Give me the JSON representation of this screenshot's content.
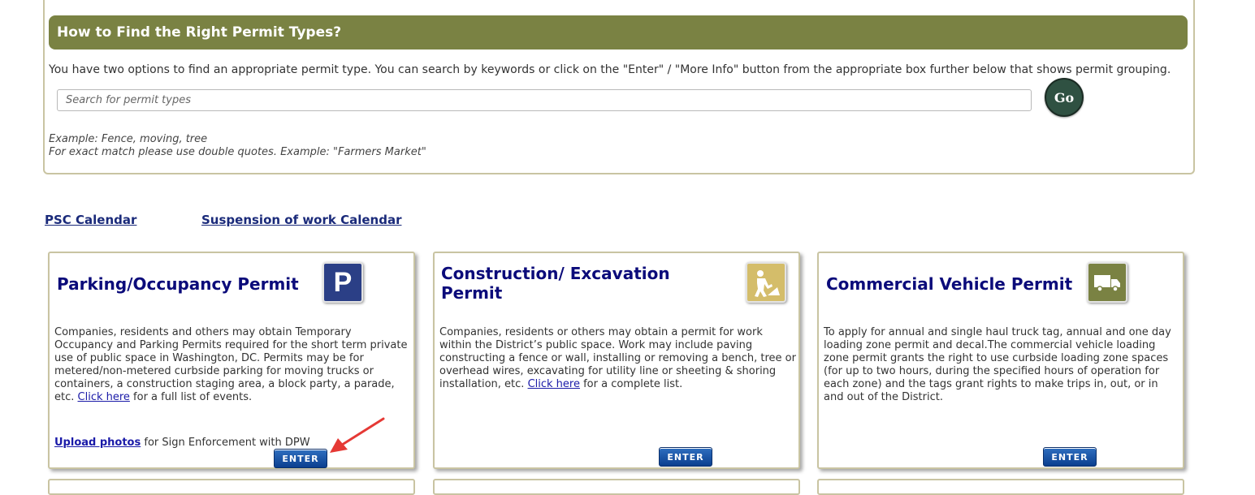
{
  "search_panel": {
    "heading": "How to Find the Right Permit Types?",
    "intro": "You have two options to find an appropriate permit type. You can search by keywords or click on the \"Enter\" / \"More Info\" button from the appropriate box further below that shows permit grouping.",
    "search_placeholder": "Search for permit types",
    "search_value": "",
    "go_label": "Go",
    "example_line1": "Example: Fence, moving, tree",
    "example_line2": "For exact match please use double quotes. Example: \"Farmers Market\""
  },
  "calendar_links": {
    "psc": "PSC Calendar",
    "suspension": "Suspension of work Calendar"
  },
  "cards": [
    {
      "title": "Parking/Occupancy Permit",
      "icon": "parking-p-icon",
      "icon_letter": "P",
      "icon_color": "#2b3f86",
      "desc_before_link": "Companies, residents and others may obtain Temporary Occupancy and Parking Permits required for the short term private use of public space in Washington, DC. Permits may be for metered/non-metered curbside parking for moving trucks or containers, a construction staging area, a block party, a parade, etc. ",
      "link_text": "Click here",
      "desc_after_link": " for a full list of events.",
      "upload_link": "Upload photos",
      "upload_suffix": " for Sign Enforcement with DPW",
      "enter_label": "ENTER"
    },
    {
      "title": "Construction/ Excavation Permit",
      "icon": "construction-worker-icon",
      "icon_color": "#d4bd6a",
      "desc_before_link": "Companies, residents or others may obtain a permit for work within the District’s public space. Work may include paving constructing a fence or wall, installing or removing a bench, tree or overhead wires, excavating for utility line or sheeting & shoring installation, etc. ",
      "link_text": "Click here",
      "desc_after_link": " for a complete list.",
      "enter_label": "ENTER"
    },
    {
      "title": "Commercial Vehicle Permit",
      "icon": "truck-icon",
      "icon_color": "#7a8243",
      "description": "To apply for annual and single haul truck tag, annual and one day loading zone permit and decal.The commercial vehicle loading zone permit grants the right to use curbside loading zone spaces (for up to two hours, during the specified hours of operation for each zone) and the tags grant rights to make trips in, out, or in and out of the District.",
      "enter_label": "ENTER"
    }
  ],
  "annotation": {
    "icon": "red-arrow-icon",
    "color": "#e53935"
  }
}
